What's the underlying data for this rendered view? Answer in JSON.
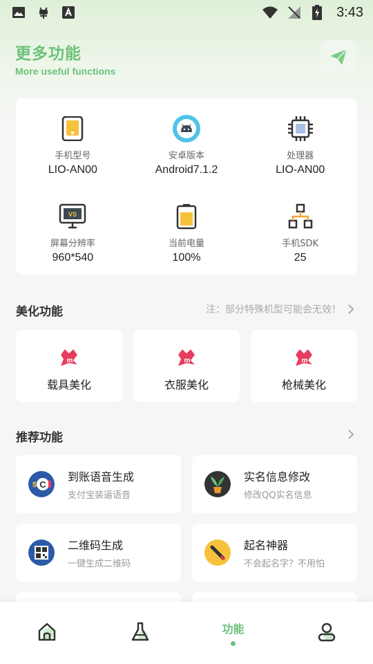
{
  "status_bar": {
    "time": "3:43",
    "left_icons": [
      "image-icon",
      "bug-icon",
      "font-icon"
    ],
    "right_icons": [
      "wifi-icon",
      "no-signal-icon",
      "battery-charging-icon"
    ]
  },
  "header": {
    "title": "更多功能",
    "subtitle": "More useful functions",
    "action_icon": "send-icon"
  },
  "device_info": [
    {
      "label": "手机型号",
      "value": "LIO-AN00",
      "icon": "phone-icon"
    },
    {
      "label": "安卓版本",
      "value": "Android7.1.2",
      "icon": "android-icon"
    },
    {
      "label": "处理器",
      "value": "LIO-AN00",
      "icon": "cpu-icon"
    },
    {
      "label": "屏幕分辨率",
      "value": "960*540",
      "icon": "monitor-icon"
    },
    {
      "label": "当前电量",
      "value": "100%",
      "icon": "battery-icon"
    },
    {
      "label": "手机SDK",
      "value": "25",
      "icon": "network-icon"
    }
  ],
  "beauty_section": {
    "title": "美化功能",
    "note": "注：部分特殊机型可能会无效！",
    "items": [
      {
        "label": "载具美化",
        "icon": "brand-m-icon"
      },
      {
        "label": "衣服美化",
        "icon": "brand-m-icon"
      },
      {
        "label": "枪械美化",
        "icon": "brand-m-icon"
      }
    ]
  },
  "recommend_section": {
    "title": "推荐功能",
    "items": [
      {
        "title": "到账语音生成",
        "subtitle": "支付宝装逼语音",
        "icon": "money-voice-icon"
      },
      {
        "title": "实名信息修改",
        "subtitle": "修改QQ实名信息",
        "icon": "plant-icon"
      },
      {
        "title": "二维码生成",
        "subtitle": "一键生成二维码",
        "icon": "qr-icon"
      },
      {
        "title": "起名神器",
        "subtitle": "不会起名字？不用怕",
        "icon": "pen-icon"
      }
    ]
  },
  "bottom_nav": {
    "items": [
      {
        "name": "home",
        "icon": "home-icon"
      },
      {
        "name": "lab",
        "icon": "flask-icon"
      },
      {
        "name": "features",
        "label": "功能",
        "active": true
      },
      {
        "name": "profile",
        "icon": "user-icon"
      }
    ]
  },
  "colors": {
    "accent": "#6cc27a",
    "background": "#f6f6f6"
  }
}
